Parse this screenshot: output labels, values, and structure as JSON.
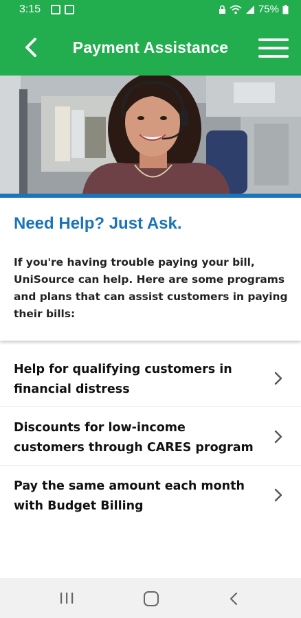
{
  "status_bar": {
    "time": "3:15",
    "battery": "75%",
    "icons": [
      "image-icon",
      "app-icon",
      "lock-icon",
      "wifi-icon",
      "signal-icon",
      "battery-icon"
    ]
  },
  "header": {
    "title": "Payment Assistance",
    "back_icon": "back-arrow-icon",
    "menu_icon": "hamburger-menu-icon",
    "background_color": "#22ad4e"
  },
  "hero": {
    "image": "customer-service-agent-with-headset-photo",
    "accent_color": "#1b74b8"
  },
  "intro": {
    "title": "Need Help? Just Ask.",
    "body": "If you're having trouble paying your bill, UniSource can help. Here are some programs and plans that can assist customers in paying their bills:",
    "title_color": "#1b74b8"
  },
  "programs": [
    {
      "label": "Help for qualifying customers in financial distress",
      "icon": "chevron-right-icon"
    },
    {
      "label": "Discounts for low-income customers through CARES program",
      "icon": "chevron-right-icon"
    },
    {
      "label": "Pay the same amount each month with Budget Billing",
      "icon": "chevron-right-icon"
    }
  ],
  "nav_bar": {
    "buttons": [
      "recents-icon",
      "home-icon",
      "back-icon"
    ]
  }
}
